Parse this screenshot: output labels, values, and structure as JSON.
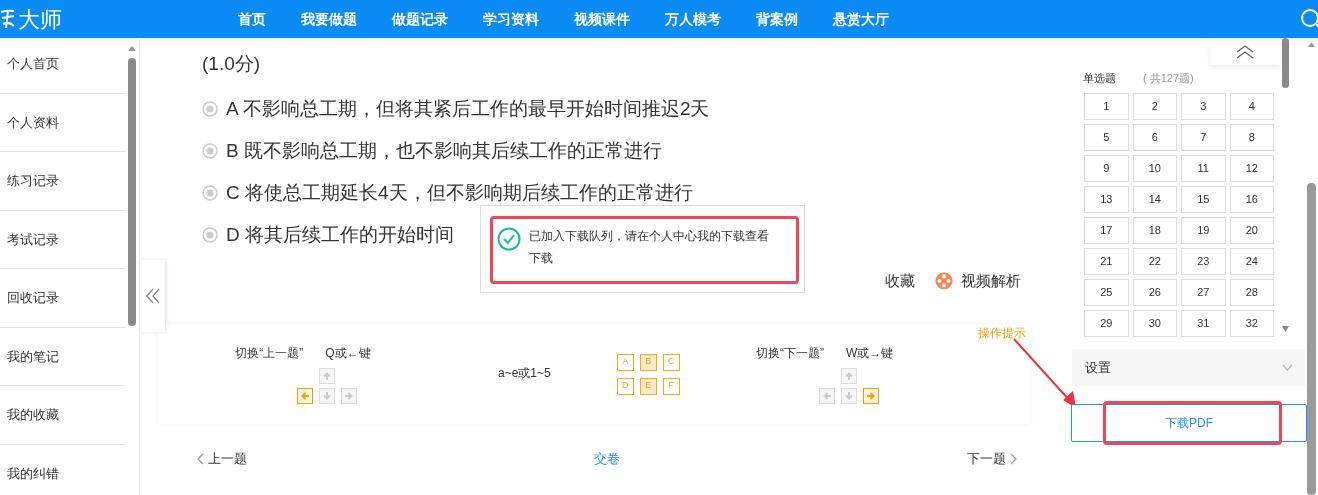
{
  "header": {
    "logo": "大师",
    "nav": [
      {
        "label": "首页",
        "selected": false
      },
      {
        "label": "我要做题",
        "selected": false
      },
      {
        "label": "做题记录",
        "selected": false
      },
      {
        "label": "学习资料",
        "selected": false
      },
      {
        "label": "视频课件",
        "selected": false
      },
      {
        "label": "万人模考",
        "selected": false
      },
      {
        "label": "背案例",
        "selected": false
      },
      {
        "label": "悬赏大厅",
        "selected": false
      }
    ]
  },
  "sidebar": {
    "items": [
      {
        "label": "个人首页"
      },
      {
        "label": "个人资料"
      },
      {
        "label": "练习记录"
      },
      {
        "label": "考试记录"
      },
      {
        "label": "回收记录"
      },
      {
        "label": "我的笔记"
      },
      {
        "label": "我的收藏"
      },
      {
        "label": "我的纠错"
      }
    ]
  },
  "question": {
    "score": "(1.0分)",
    "options": [
      {
        "text": "A 不影响总工期，但将其紧后工作的最早开始时间推迟2天",
        "selected": false
      },
      {
        "text": "B 既不影响总工期，也不影响其后续工作的正常进行",
        "selected": false
      },
      {
        "text": "C 将使总工期延长4天，但不影响期后续工作的正常进行",
        "selected": false
      },
      {
        "text": "D 将其后续工作的开始时间",
        "selected": false
      }
    ],
    "actions": [
      {
        "kind": "favorite",
        "label": "收藏"
      },
      {
        "kind": "video",
        "label": "视频解析"
      }
    ]
  },
  "toast": {
    "line1": "已加入下载队列，请在个人中心我的下载查看",
    "line2": "下载"
  },
  "hint": "操作提示",
  "shortcuts": {
    "prev": {
      "label": "切换“上一题”",
      "keys": "Q或←键",
      "arrows": [
        {
          "kind": "up",
          "active": false
        },
        {
          "kind": "left",
          "active": true
        },
        {
          "kind": "down",
          "active": false
        },
        {
          "kind": "right",
          "active": false
        }
      ]
    },
    "middle": "a~e或1~5",
    "letters": [
      {
        "label": "A",
        "filled": false
      },
      {
        "label": "B",
        "filled": true
      },
      {
        "label": "C",
        "filled": false
      },
      {
        "label": "D",
        "filled": false
      },
      {
        "label": "E",
        "filled": true
      },
      {
        "label": "F",
        "filled": false
      }
    ],
    "next": {
      "label": "切换“下一题”",
      "keys": "W或→键",
      "arrows": [
        {
          "kind": "up",
          "active": false
        },
        {
          "kind": "left",
          "active": false
        },
        {
          "kind": "down",
          "active": false
        },
        {
          "kind": "right",
          "active": true
        }
      ]
    }
  },
  "footer": {
    "prev": "上一题",
    "submit": "交卷",
    "next": "下一题"
  },
  "answer_sheet": {
    "section": "单选题",
    "count": "( 共127题)",
    "numbers": [
      "1",
      "2",
      "3",
      "4",
      "5",
      "6",
      "7",
      "8",
      "9",
      "10",
      "11",
      "12",
      "13",
      "14",
      "15",
      "16",
      "17",
      "18",
      "19",
      "20",
      "21",
      "22",
      "23",
      "24",
      "25",
      "26",
      "27",
      "28",
      "29",
      "30",
      "31",
      "32"
    ]
  },
  "settings": {
    "label": "设置"
  },
  "download_button": "下载PDF"
}
